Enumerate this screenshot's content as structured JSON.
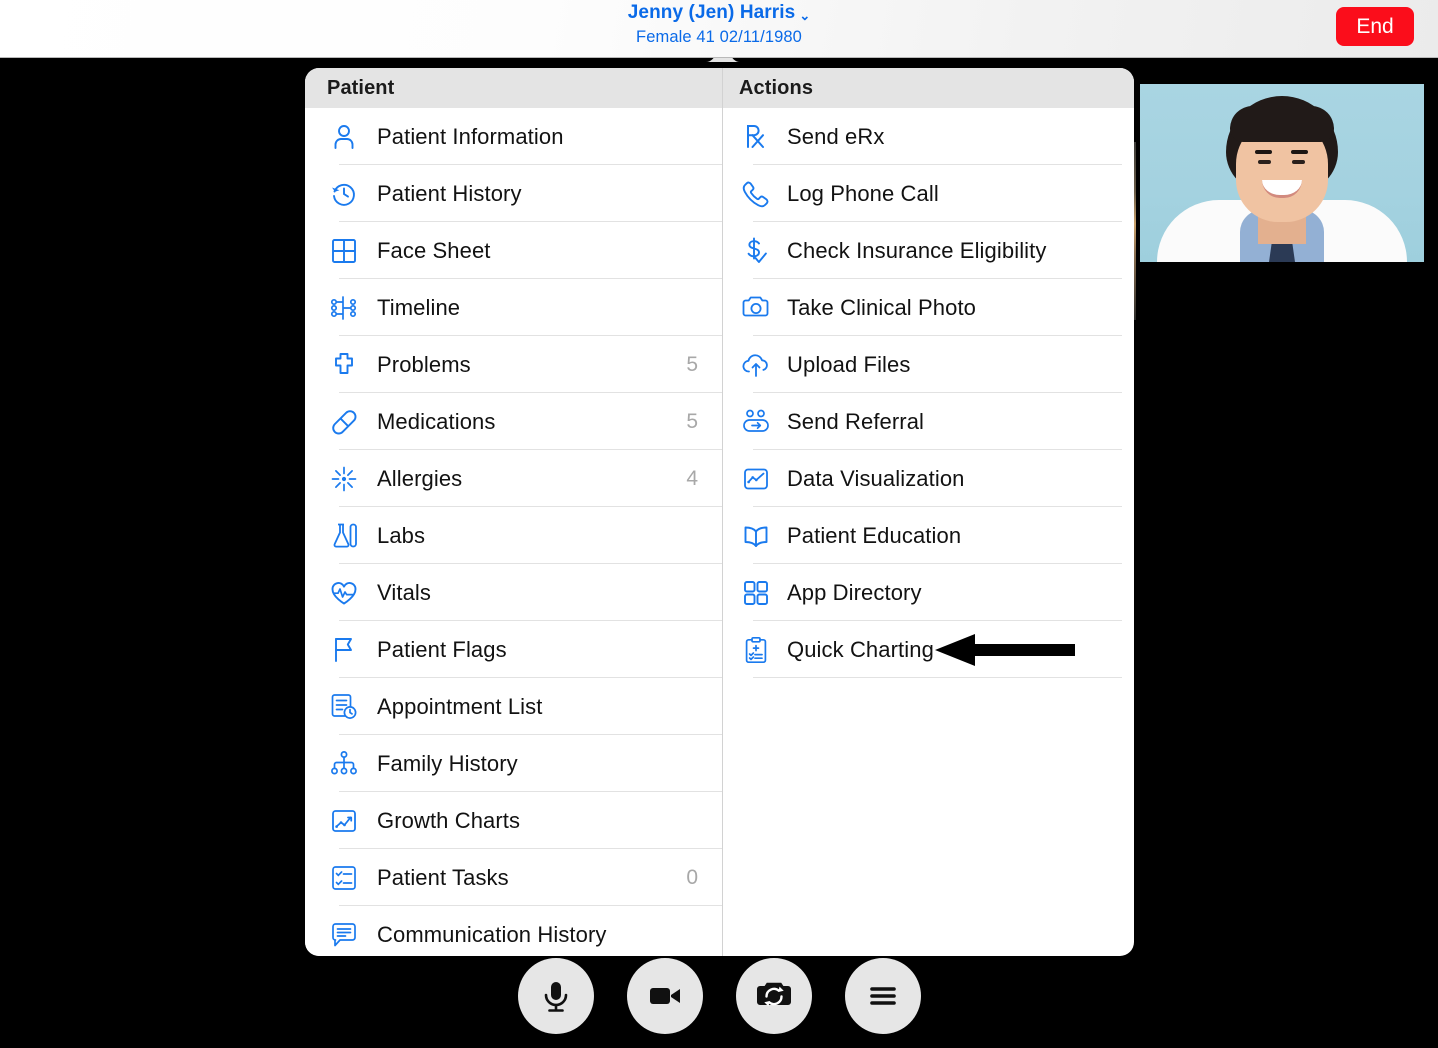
{
  "header": {
    "patient_name": "Jenny (Jen) Harris",
    "name_chevron_icon": "chevron-down-icon",
    "patient_details": "Female 41 02/11/1980",
    "end_button_label": "End",
    "accent_color": "#0a6ae8",
    "end_button_color": "#fb0d1b"
  },
  "popover": {
    "patient_section": {
      "title": "Patient",
      "items": [
        {
          "label": "Patient Information",
          "icon": "person-icon",
          "count": ""
        },
        {
          "label": "Patient History",
          "icon": "clock-rewind-icon",
          "count": ""
        },
        {
          "label": "Face Sheet",
          "icon": "grid-four-icon",
          "count": ""
        },
        {
          "label": "Timeline",
          "icon": "timeline-icon",
          "count": ""
        },
        {
          "label": "Problems",
          "icon": "medical-cross-icon",
          "count": "5"
        },
        {
          "label": "Medications",
          "icon": "pill-capsule-icon",
          "count": "5"
        },
        {
          "label": "Allergies",
          "icon": "allergy-burst-icon",
          "count": "4"
        },
        {
          "label": "Labs",
          "icon": "lab-flask-icon",
          "count": ""
        },
        {
          "label": "Vitals",
          "icon": "heart-pulse-icon",
          "count": ""
        },
        {
          "label": "Patient Flags",
          "icon": "flag-icon",
          "count": ""
        },
        {
          "label": "Appointment List",
          "icon": "list-clock-icon",
          "count": ""
        },
        {
          "label": "Family History",
          "icon": "family-tree-icon",
          "count": ""
        },
        {
          "label": "Growth Charts",
          "icon": "growth-chart-icon",
          "count": ""
        },
        {
          "label": "Patient Tasks",
          "icon": "checklist-icon",
          "count": "0"
        },
        {
          "label": "Communication History",
          "icon": "comment-lines-icon",
          "count": ""
        }
      ]
    },
    "actions_section": {
      "title": "Actions",
      "items": [
        {
          "label": "Send eRx",
          "icon": "rx-icon"
        },
        {
          "label": "Log Phone Call",
          "icon": "phone-icon"
        },
        {
          "label": "Check Insurance Eligibility",
          "icon": "dollar-check-icon"
        },
        {
          "label": "Take Clinical Photo",
          "icon": "camera-icon"
        },
        {
          "label": "Upload Files",
          "icon": "cloud-upload-icon"
        },
        {
          "label": "Send Referral",
          "icon": "send-referral-icon"
        },
        {
          "label": "Data Visualization",
          "icon": "line-chart-icon"
        },
        {
          "label": "Patient Education",
          "icon": "open-book-icon"
        },
        {
          "label": "App Directory",
          "icon": "app-grid-icon"
        },
        {
          "label": "Quick Charting",
          "icon": "clipboard-checklist-icon"
        }
      ]
    },
    "icon_color": "#1a7aee"
  },
  "annotation": {
    "arrow_icon": "left-arrow-annotation",
    "points_at": "Quick Charting",
    "color": "#000000"
  },
  "video": {
    "self_view_label": "self-view-thumbnail",
    "stage_background": "#000000"
  },
  "call_controls": [
    {
      "label": "Microphone",
      "icon": "microphone-icon"
    },
    {
      "label": "Camera",
      "icon": "video-camera-icon"
    },
    {
      "label": "Flip Camera",
      "icon": "camera-flip-icon"
    },
    {
      "label": "More",
      "icon": "hamburger-menu-icon"
    }
  ]
}
